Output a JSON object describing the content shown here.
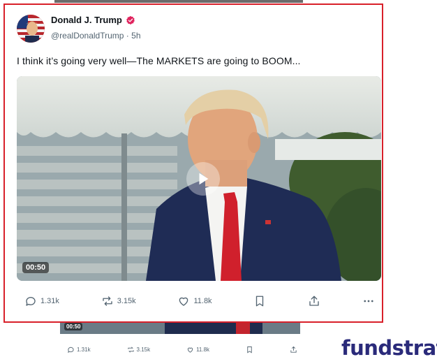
{
  "post": {
    "display_name": "Donald J. Trump",
    "handle": "@realDonaldTrump",
    "separator": "·",
    "age": "5h",
    "text": "I think it’s going very well—The MARKETS are going to BOOM...",
    "video_duration": "00:50",
    "stats": {
      "replies": "1.31k",
      "reposts": "3.15k",
      "likes": "11.8k"
    },
    "verified_color": "#e0245e"
  },
  "background_post": {
    "video_duration": "00:50",
    "stats": {
      "replies": "1.31k",
      "reposts": "3.15k",
      "likes": "11.8k"
    }
  },
  "brand": {
    "name": "fundstrat",
    "color": "#2a2a7a"
  },
  "highlight_color": "#d8202a",
  "icons": [
    "verified-badge-icon",
    "play-icon",
    "reply-icon",
    "repost-icon",
    "like-icon",
    "bookmark-icon",
    "share-icon",
    "more-icon"
  ]
}
